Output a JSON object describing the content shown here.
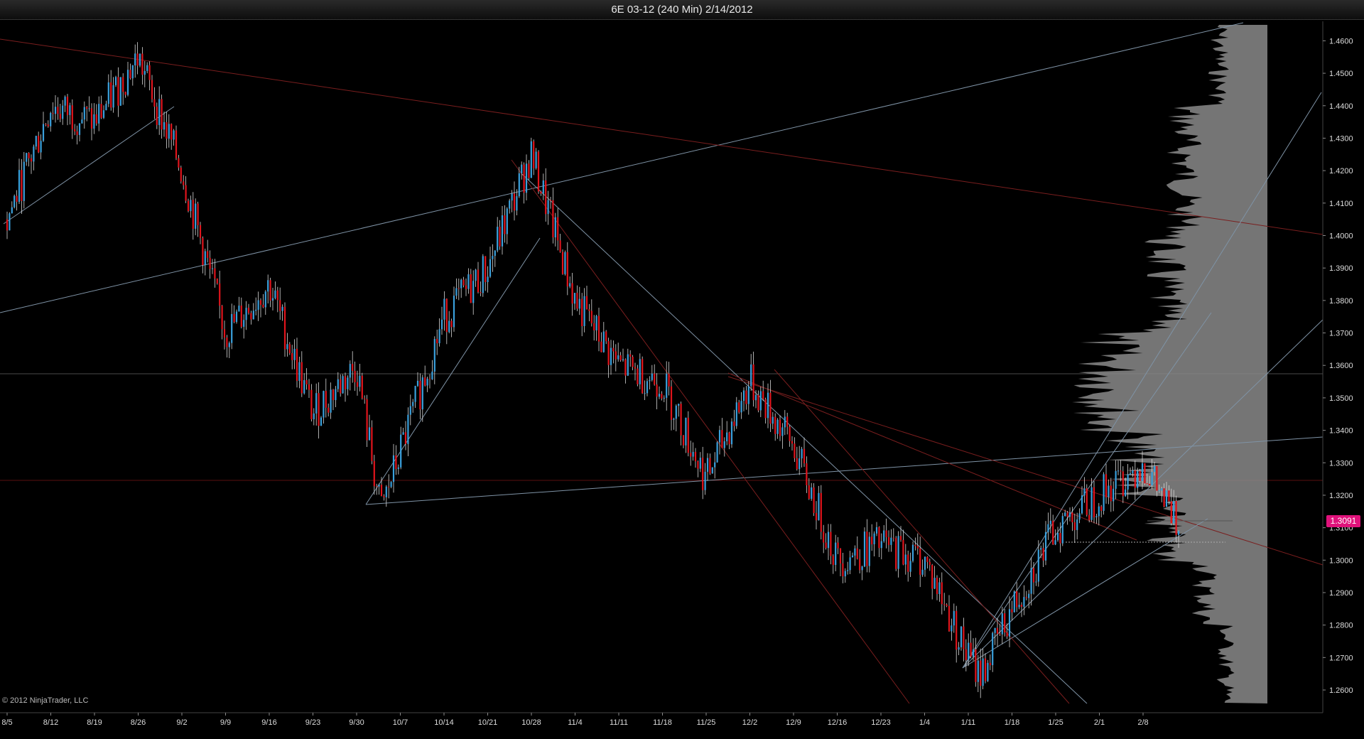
{
  "window": {
    "title": "6E 03-12 (240 Min)  2/14/2012"
  },
  "copyright": "© 2012 NinjaTrader, LLC",
  "last_price_label": "1.3091",
  "colors": {
    "background": "#000000",
    "up_bar": "#3aa0dc",
    "down_bar": "#e0141c",
    "wick": "#d8d8d8",
    "trendline_blue": "#7f93a6",
    "trendline_red": "#7a1e1e",
    "horizontal_red": "#5a1010",
    "volume_profile": "#8a8a8a",
    "price_marker": "#e0127b",
    "axis_text": "#dddddd"
  },
  "chart_data": {
    "type": "candlestick",
    "instrument": "6E 03-12",
    "interval": "240 Min",
    "date": "2/14/2012",
    "y_tick_labels": [
      "1.4600",
      "1.4500",
      "1.4400",
      "1.4300",
      "1.4200",
      "1.4100",
      "1.4000",
      "1.3900",
      "1.3800",
      "1.3700",
      "1.3600",
      "1.3500",
      "1.3400",
      "1.3300",
      "1.3200",
      "1.3100",
      "1.3000",
      "1.2900",
      "1.2800",
      "1.2700",
      "1.2600"
    ],
    "x_tick_labels": [
      "8/5",
      "8/12",
      "8/19",
      "8/26",
      "9/2",
      "9/9",
      "9/16",
      "9/23",
      "9/30",
      "10/7",
      "10/14",
      "10/21",
      "10/28",
      "11/4",
      "11/11",
      "11/18",
      "11/25",
      "12/2",
      "12/9",
      "12/16",
      "12/23",
      "1/4",
      "1/11",
      "1/18",
      "1/25",
      "2/1",
      "2/8"
    ],
    "ylim": [
      1.253,
      1.466
    ],
    "last_price": 1.3091,
    "volume_profile": true,
    "price_path": [
      [
        "8/5",
        1.405
      ],
      [
        "8/12",
        1.44
      ],
      [
        "8/19",
        1.435
      ],
      [
        "8/26",
        1.455
      ],
      [
        "9/2",
        1.42
      ],
      [
        "9/9",
        1.37
      ],
      [
        "9/16",
        1.385
      ],
      [
        "9/23",
        1.345
      ],
      [
        "9/30",
        1.36
      ],
      [
        "10/4",
        1.315
      ],
      [
        "10/14",
        1.375
      ],
      [
        "10/21",
        1.39
      ],
      [
        "10/28",
        1.425
      ],
      [
        "11/4",
        1.38
      ],
      [
        "11/11",
        1.36
      ],
      [
        "11/18",
        1.355
      ],
      [
        "11/25",
        1.325
      ],
      [
        "12/2",
        1.355
      ],
      [
        "12/9",
        1.335
      ],
      [
        "12/16",
        1.3
      ],
      [
        "12/23",
        1.305
      ],
      [
        "1/4",
        1.3
      ],
      [
        "1/11",
        1.27
      ],
      [
        "1/13",
        1.265
      ],
      [
        "1/18",
        1.285
      ],
      [
        "1/25",
        1.31
      ],
      [
        "2/1",
        1.32
      ],
      [
        "2/8",
        1.33
      ],
      [
        "2/14",
        1.3091
      ]
    ]
  }
}
